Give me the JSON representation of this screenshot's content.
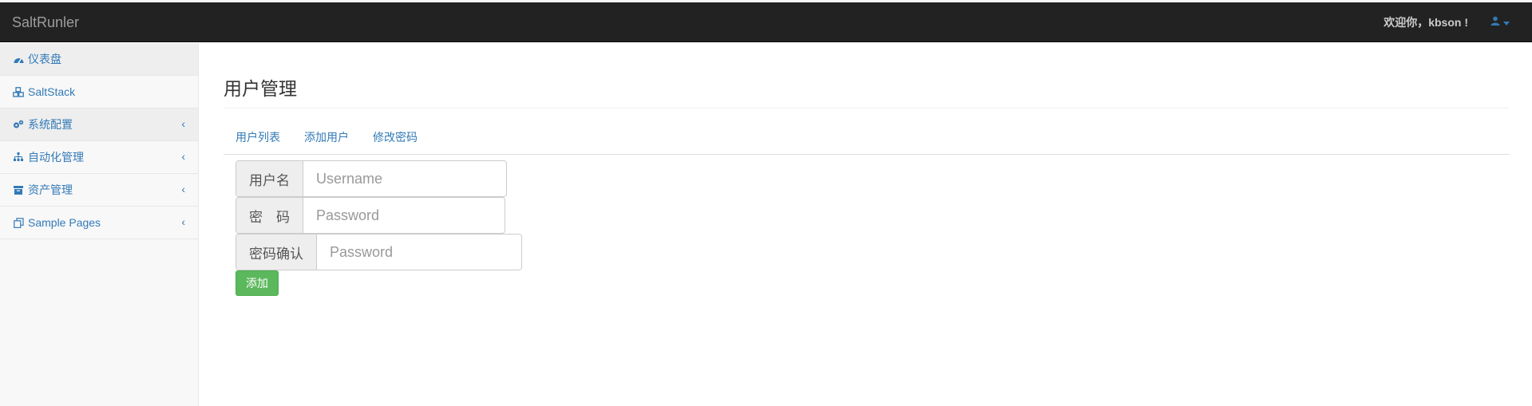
{
  "navbar": {
    "brand": "SaltRunler",
    "welcome": "欢迎你，kbson !",
    "user_icon": "user-icon",
    "caret_icon": "caret-down-icon"
  },
  "sidebar": {
    "items": [
      {
        "label": "仪表盘",
        "icon": "dashboard-icon",
        "has_arrow": false
      },
      {
        "label": "SaltStack",
        "icon": "cubes-icon",
        "has_arrow": false
      },
      {
        "label": "系统配置",
        "icon": "gears-icon",
        "has_arrow": true
      },
      {
        "label": "自动化管理",
        "icon": "sitemap-icon",
        "has_arrow": true
      },
      {
        "label": "资产管理",
        "icon": "archive-icon",
        "has_arrow": true
      },
      {
        "label": "Sample Pages",
        "icon": "files-icon",
        "has_arrow": true
      }
    ],
    "arrow": "‹"
  },
  "main": {
    "title": "用户管理",
    "tabs": [
      "用户列表",
      "添加用户",
      "修改密码"
    ],
    "form": {
      "username": {
        "label": "用户名",
        "placeholder": "Username",
        "value": ""
      },
      "password": {
        "label": "密　码",
        "placeholder": "Password",
        "value": ""
      },
      "confirm": {
        "label": "密码确认",
        "placeholder": "Password",
        "value": ""
      },
      "submit_label": "添加"
    }
  },
  "colors": {
    "navbar_bg": "#222222",
    "link": "#337ab7",
    "success": "#5cb85c",
    "sidebar_bg": "#f8f8f8"
  }
}
